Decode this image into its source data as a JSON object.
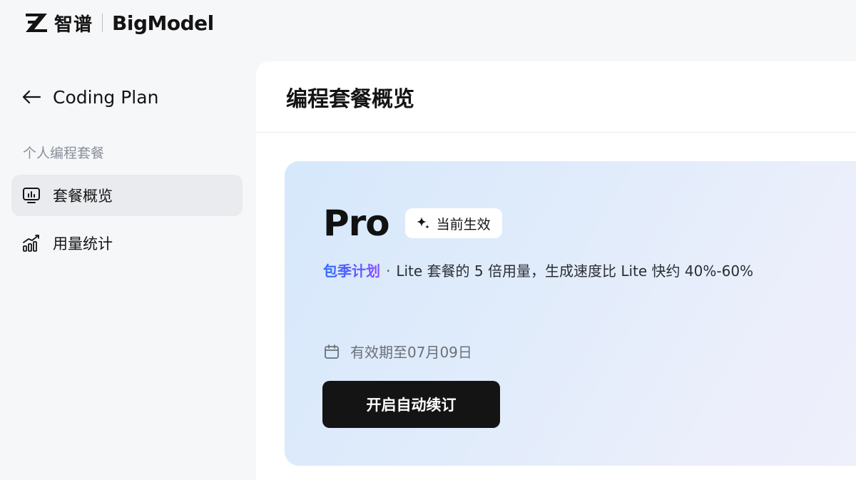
{
  "brand": {
    "name_cn": "智谱",
    "name_en": "BigModel"
  },
  "sidebar": {
    "back_label": "Coding Plan",
    "section_label": "个人编程套餐",
    "items": [
      {
        "label": "套餐概览",
        "icon": "monitor-chart-icon",
        "active": true
      },
      {
        "label": "用量统计",
        "icon": "usage-chart-icon",
        "active": false
      }
    ]
  },
  "main": {
    "title": "编程套餐概览"
  },
  "plan": {
    "name": "Pro",
    "status": "当前生效",
    "type": "包季计划",
    "separator": "·",
    "description": "Lite 套餐的 5 倍用量，生成速度比 Lite 快约 40%-60%",
    "expiry": "有效期至07月09日",
    "renew_button": "开启自动续订"
  },
  "colors": {
    "accent_gradient_start": "#2f6bff",
    "accent_gradient_end": "#8a4dff",
    "button_bg": "#141414",
    "card_bg": "#dfeafb"
  }
}
